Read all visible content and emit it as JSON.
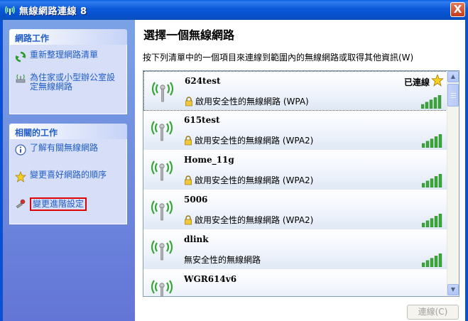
{
  "window": {
    "title": "無線網路連線 8",
    "close_label": "X"
  },
  "sidebar": {
    "network_tasks": {
      "header": "網路工作",
      "items": [
        {
          "label": "重新整理網路清單",
          "icon": "refresh-icon"
        },
        {
          "label": "為住家或小型辦公室設定無線網路",
          "icon": "setup-wireless-icon"
        }
      ]
    },
    "related_tasks": {
      "header": "相關的工作",
      "items": [
        {
          "label": "了解有關無線網路",
          "icon": "info-icon"
        },
        {
          "label": "變更喜好網路的順序",
          "icon": "star-icon"
        },
        {
          "label": "變更進階設定",
          "icon": "settings-icon"
        }
      ]
    }
  },
  "main": {
    "heading": "選擇一個無線網路",
    "instruction": "按下列清單中的一個項目來連線到範圍內的無線網路或取得其他資訊(W)",
    "networks": [
      {
        "ssid": "624test",
        "security": "啟用安全性的無線網路 (WPA)",
        "status": "已連線",
        "secured": true,
        "signal_bars": 5
      },
      {
        "ssid": "615test",
        "security": "啟用安全性的無線網路 (WPA2)",
        "status": "",
        "secured": true,
        "signal_bars": 5
      },
      {
        "ssid": "Home_11g",
        "security": "啟用安全性的無線網路 (WPA2)",
        "status": "",
        "secured": true,
        "signal_bars": 5
      },
      {
        "ssid": "5006",
        "security": "啟用安全性的無線網路 (WPA2)",
        "status": "",
        "secured": true,
        "signal_bars": 5
      },
      {
        "ssid": "dlink",
        "security": "無安全性的無線網路",
        "status": "",
        "secured": false,
        "signal_bars": 5
      },
      {
        "ssid": "WGR614v6",
        "security": "",
        "status": "",
        "secured": false,
        "signal_bars": 5
      }
    ],
    "connect_label": "連線(C)"
  },
  "colors": {
    "title_bar": "#0c59d8",
    "sidebar_bg": "#7ba2e7",
    "task_link": "#215dc6",
    "signal_green": "#3aa63a",
    "highlight_box": "#e00000"
  }
}
